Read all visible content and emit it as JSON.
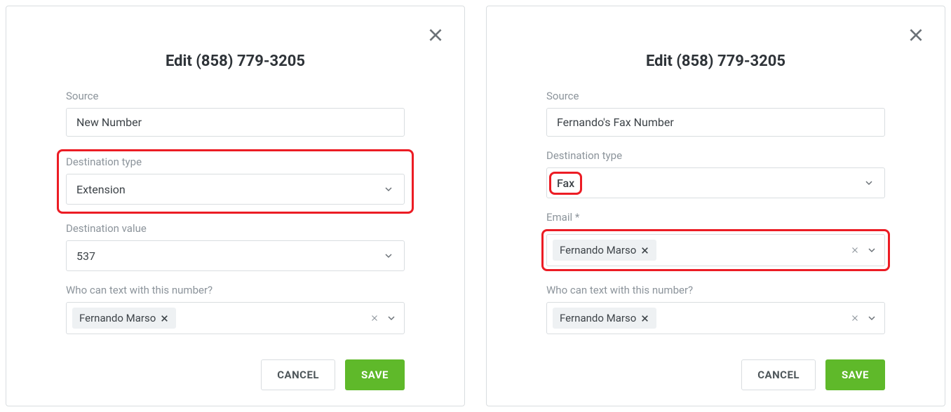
{
  "left": {
    "title": "Edit (858) 779-3205",
    "labels": {
      "source": "Source",
      "destType": "Destination type",
      "destValue": "Destination value",
      "whoText": "Who can text with this number?"
    },
    "source": "New Number",
    "destType": "Extension",
    "destValue": "537",
    "whoText": "Fernando Marso",
    "cancel": "CANCEL",
    "save": "SAVE"
  },
  "right": {
    "title": "Edit (858) 779-3205",
    "labels": {
      "source": "Source",
      "destType": "Destination type",
      "email": "Email *",
      "whoText": "Who can text with this number?"
    },
    "source": "Fernando's Fax Number",
    "destType": "Fax",
    "email": "Fernando Marso",
    "whoText": "Fernando Marso",
    "cancel": "CANCEL",
    "save": "SAVE"
  }
}
